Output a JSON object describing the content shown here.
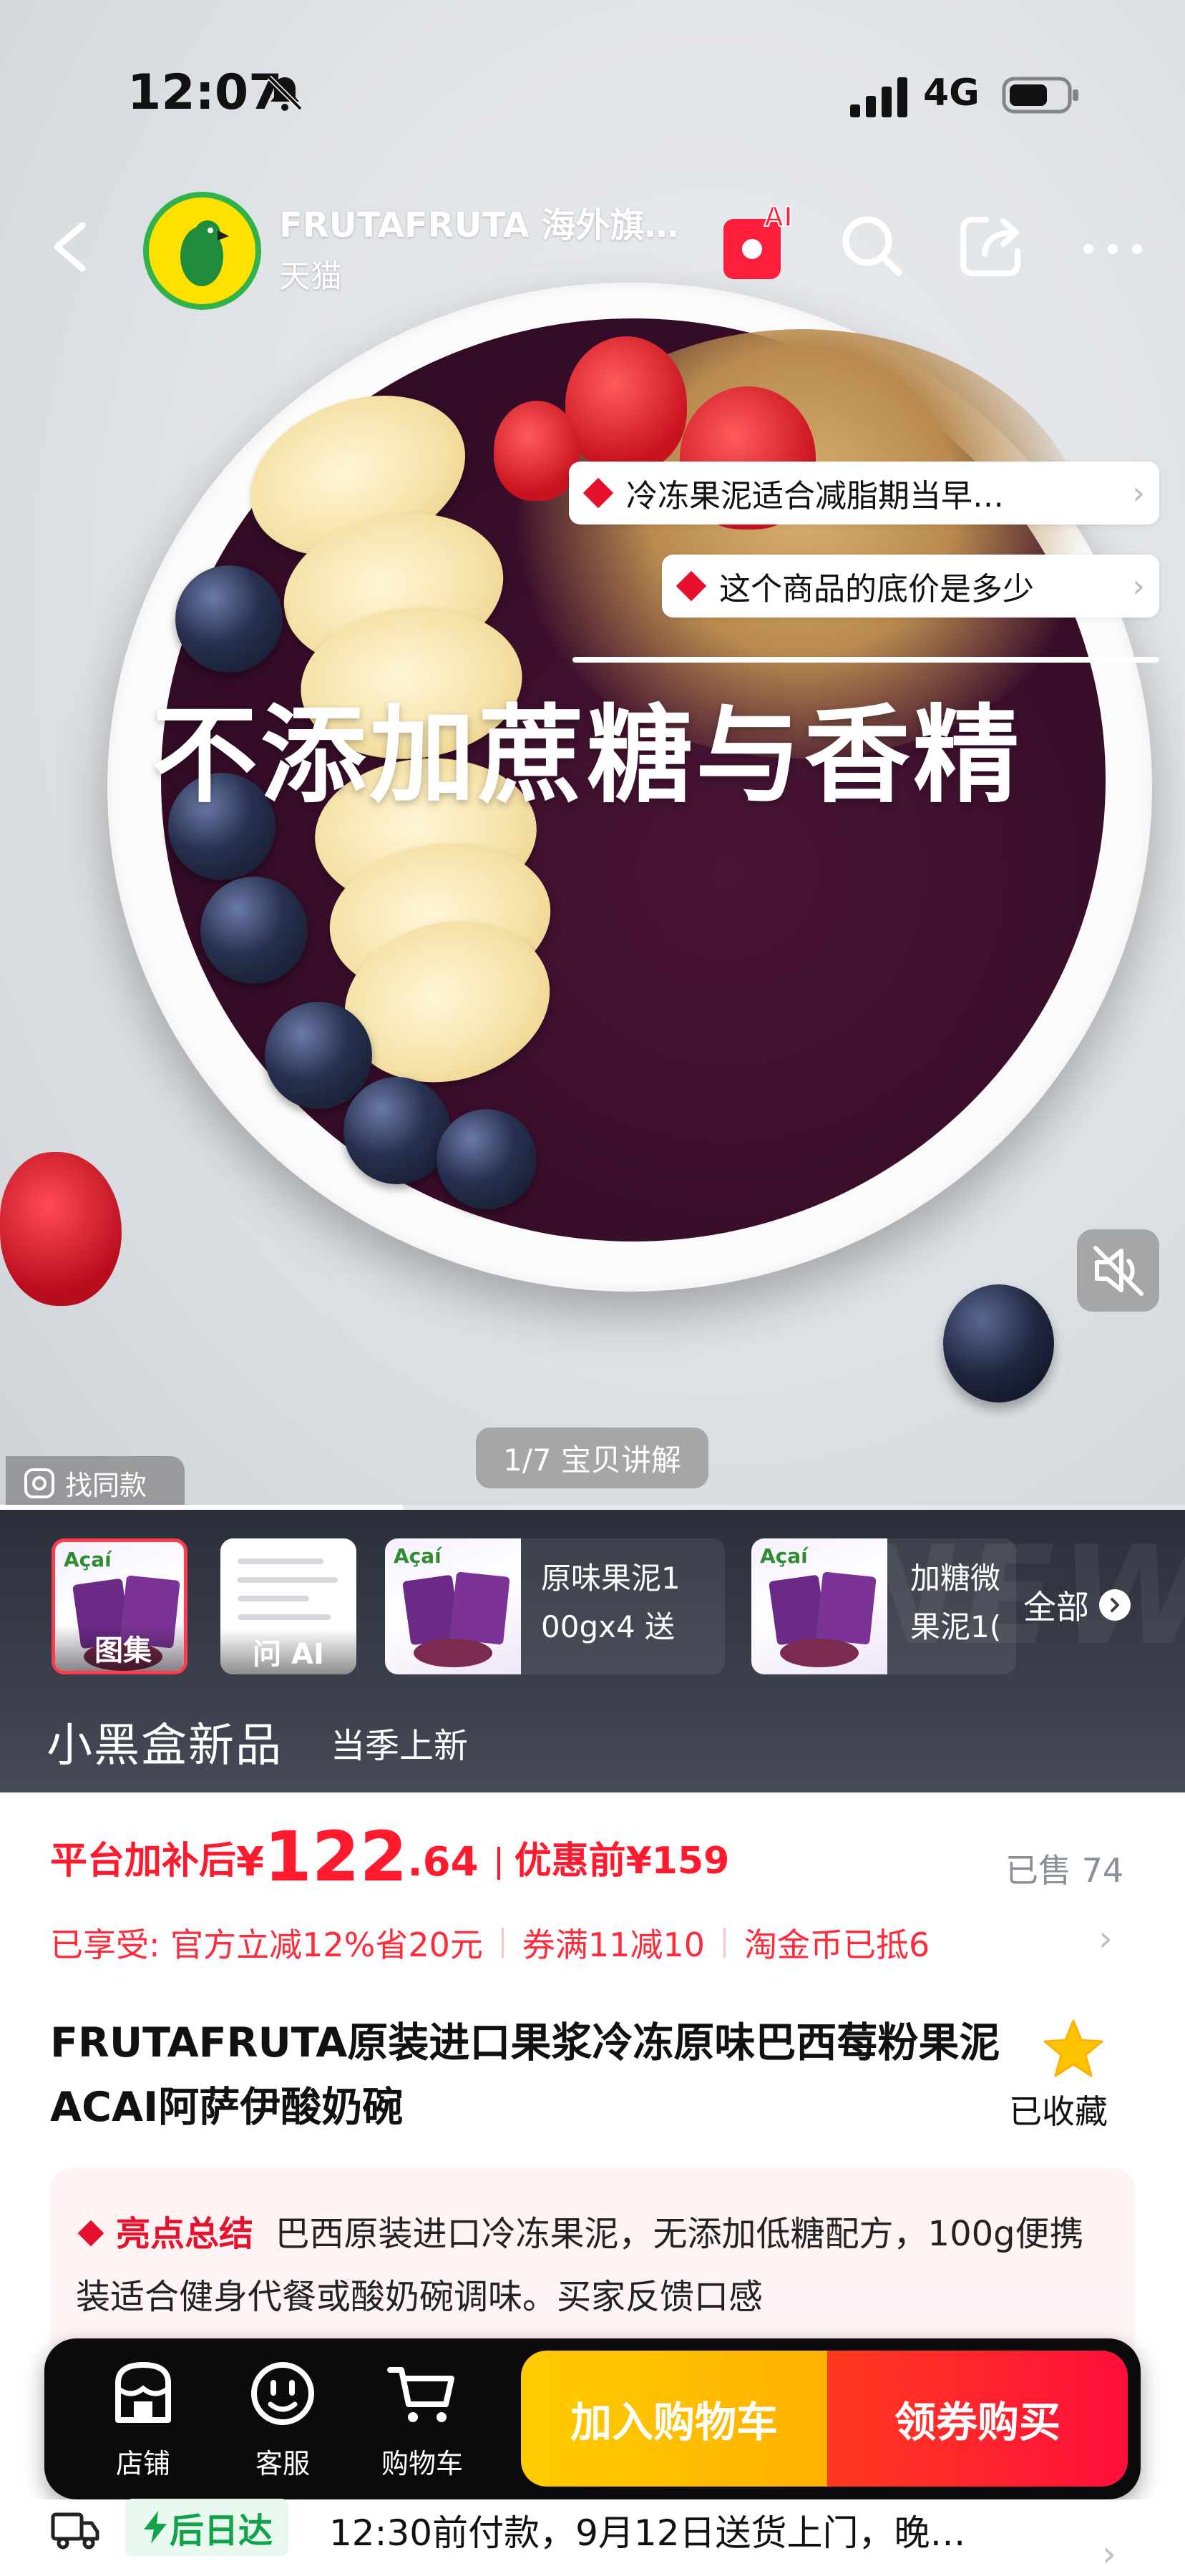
{
  "status_bar": {
    "time": "12:07",
    "network": "4G"
  },
  "nav": {
    "shop_name": "FRUTAFRUTA 海外旗…",
    "shop_platform": "天猫",
    "ai_badge": "AI"
  },
  "questions": [
    {
      "text": "冷冻果泥适合减脂期当早…"
    },
    {
      "text": "这个商品的底价是多少"
    }
  ],
  "media": {
    "overlay_title": "不添加蔗糖与香精",
    "page_indicator": "1/7 宝贝讲解",
    "find_similar": "找同款",
    "progress_fraction": 0.34
  },
  "thumb_strip": {
    "items": [
      {
        "label": "图集",
        "brand": "Açaí"
      },
      {
        "label": "问 AI"
      },
      {
        "line1": "原味果泥1",
        "line2": "00gx4 送",
        "brand": "Açaí"
      },
      {
        "line1": "加糖微",
        "line2": "果泥1(",
        "brand": "Açaí"
      }
    ],
    "all_label": "全部",
    "watermark": "NEW",
    "section_title": "小黑盒新品",
    "section_sub": "当季上新"
  },
  "price": {
    "label": "平台加补后",
    "currency": "¥",
    "integer": "122",
    "decimal": ".64",
    "original": "优惠前¥159",
    "sold": "已售 74"
  },
  "promos": [
    "已享受: 官方立减12%省20元",
    "券满11减10",
    "淘金币已抵6"
  ],
  "product": {
    "title": "FRUTAFRUTA原装进口果浆冷冻原味巴西莓粉果泥ACAI阿萨伊酸奶碗",
    "favorite_label": "已收藏"
  },
  "highlights": {
    "heading": "亮点总结",
    "text": "巴西原装进口冷冻果泥，无添加低糖配方，100g便携装适合健身代餐或酸奶碗调味。买家反馈口感"
  },
  "action_bar": {
    "shop": "店铺",
    "service": "客服",
    "cart": "购物车",
    "add_to_cart": "加入购物车",
    "buy_now": "领券购买"
  },
  "shipping": {
    "badge": "后日达",
    "text": "12:30前付款，9月12日送货上门，晚…"
  },
  "colors": {
    "accent_red": "#ff1a2e",
    "add_cart_yellow": "#ffcc00",
    "buy_red": "#ff0f3a",
    "ship_green": "#11a24a"
  }
}
